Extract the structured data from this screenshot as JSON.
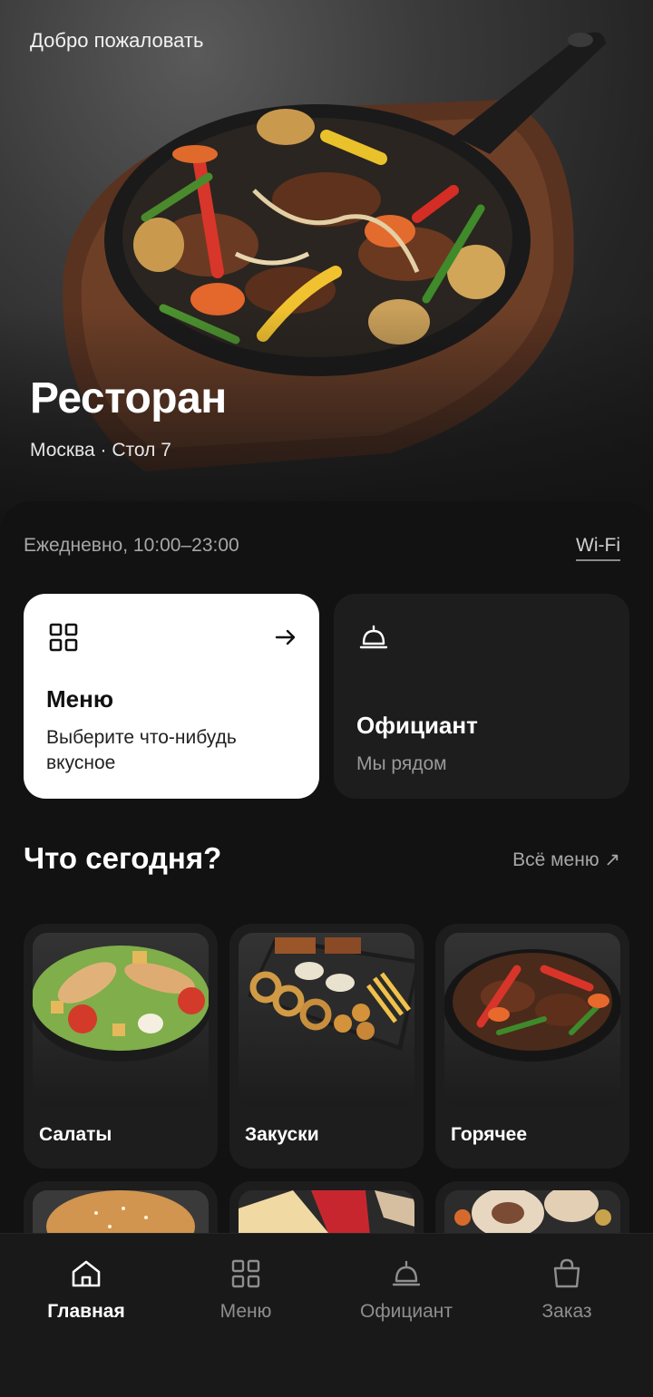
{
  "hero": {
    "welcome": "Добро пожаловать",
    "restaurant_name": "Ресторан",
    "location": "Москва · Стол 7"
  },
  "info": {
    "hours": "Ежедневно, 10:00–23:00",
    "wifi_label": "Wi-Fi"
  },
  "cards": {
    "menu": {
      "title": "Меню",
      "text": "Выберите что-нибудь вкусное",
      "icon": "grid-icon",
      "arrow_icon": "arrow-right-icon"
    },
    "waiter": {
      "title": "Официант",
      "text": "Мы рядом",
      "icon": "bell-icon"
    }
  },
  "section": {
    "title": "Что сегодня?",
    "all_menu": "Всё меню ↗"
  },
  "categories": [
    {
      "label": "Салаты",
      "image": "salad"
    },
    {
      "label": "Закуски",
      "image": "snacks"
    },
    {
      "label": "Горячее",
      "image": "hot-dish"
    },
    {
      "label": "",
      "image": "burger"
    },
    {
      "label": "",
      "image": "dessert"
    },
    {
      "label": "",
      "image": "rolls"
    }
  ],
  "nav": {
    "items": [
      {
        "label": "Главная",
        "icon": "home-icon",
        "active": true
      },
      {
        "label": "Меню",
        "icon": "grid-icon",
        "active": false
      },
      {
        "label": "Официант",
        "icon": "bell-icon",
        "active": false
      },
      {
        "label": "Заказ",
        "icon": "bag-icon",
        "active": false
      }
    ]
  },
  "colors": {
    "background": "#111111",
    "card_light": "#ffffff",
    "card_dark": "#1d1d1d",
    "muted_text": "#a7a7a7"
  }
}
